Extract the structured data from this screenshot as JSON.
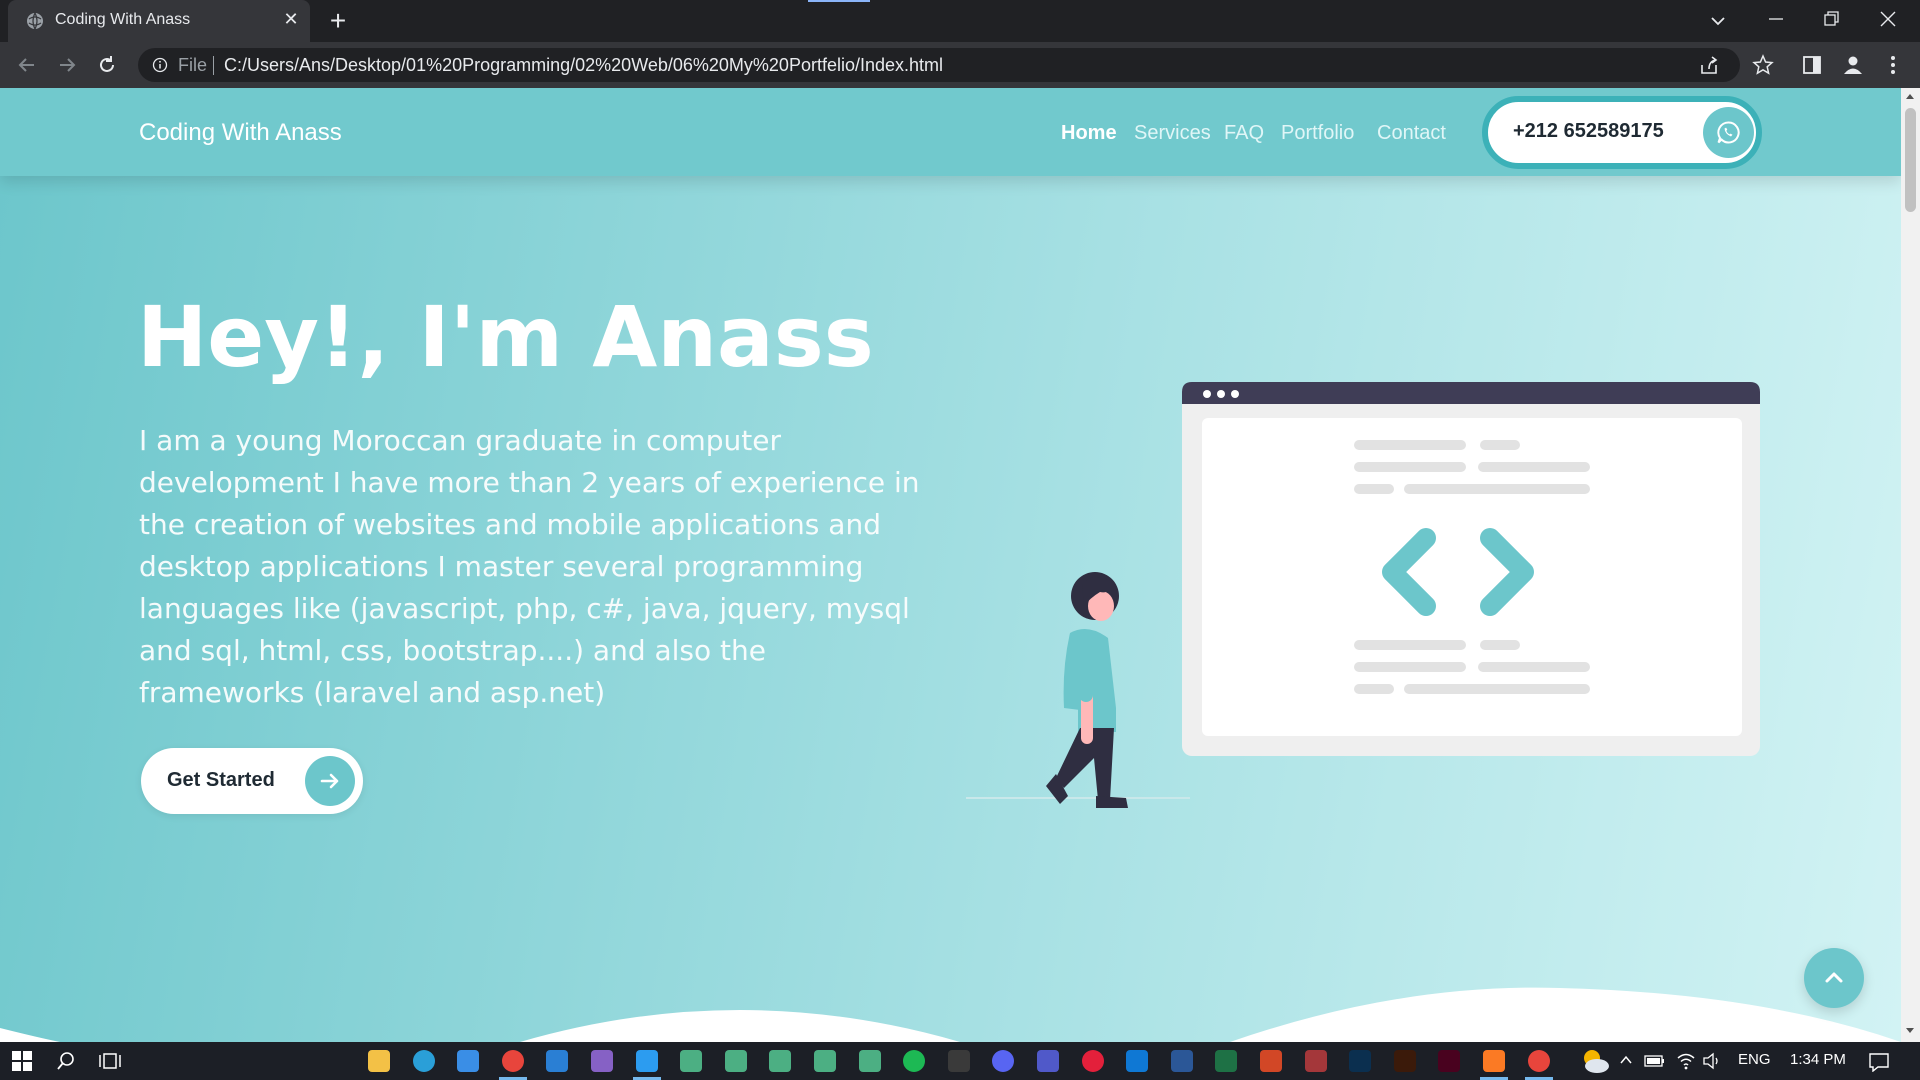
{
  "browser": {
    "tab_title": "Coding With Anass",
    "omnibox_scheme": "File",
    "url": "C:/Users/Ans/Desktop/01%20Programming/02%20Web/06%20My%20Portfelio/Index.html"
  },
  "site": {
    "logo": "Coding With Anass",
    "nav": [
      "Home",
      "Services",
      "FAQ",
      "Portfolio",
      "Contact"
    ],
    "active_nav": "Home",
    "phone": "+212 652589175",
    "hero_title": "Hey!, I'm Anass",
    "hero_text": "I am a young Moroccan graduate in computer development I have more than 2 years of experience in the creation of websites and mobile applications and desktop applications I master several programming languages like (javascript, php, c#, java, jquery, mysql and sql, html, css, bootstrap....) and also the frameworks (laravel and asp.net)",
    "cta_label": "Get Started",
    "colors": {
      "accent": "#6cc6cb",
      "header": "#71c9cd",
      "dark": "#2f2e41"
    }
  },
  "taskbar": {
    "language": "ENG",
    "time": "1:34 PM",
    "apps": [
      "file-explorer-icon",
      "edge-icon",
      "store-icon",
      "chrome-icon",
      "mail-icon",
      "visual-studio-icon",
      "vscode-icon",
      "app-icon",
      "app-icon",
      "app-icon",
      "app-icon",
      "app-icon",
      "spotify-icon",
      "epic-games-icon",
      "discord-icon",
      "teams-icon",
      "opera-icon",
      "outlook-icon",
      "word-icon",
      "excel-icon",
      "powerpoint-icon",
      "access-icon",
      "photoshop-icon",
      "illustrator-icon",
      "indesign-icon",
      "xampp-icon",
      "chrome-icon"
    ]
  }
}
